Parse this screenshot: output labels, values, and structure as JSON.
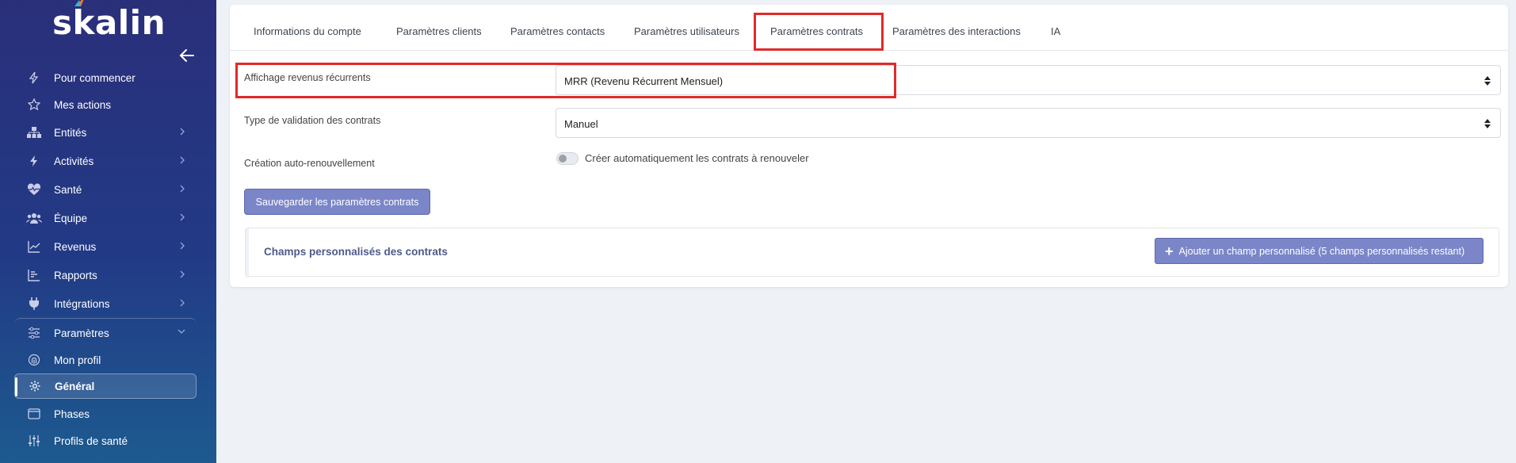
{
  "sidebar": {
    "logo": "skalin",
    "items": [
      {
        "name": "pour-commencer",
        "label": "Pour commencer",
        "icon": "bolt-icon"
      },
      {
        "name": "mes-actions",
        "label": "Mes actions",
        "icon": "star-icon"
      },
      {
        "name": "entites",
        "label": "Entités",
        "icon": "org-chart-icon"
      },
      {
        "name": "activites",
        "label": "Activités",
        "icon": "bolt-filled-icon"
      },
      {
        "name": "sante",
        "label": "Santé",
        "icon": "heart-pulse-icon"
      },
      {
        "name": "equipe",
        "label": "Équipe",
        "icon": "users-icon"
      },
      {
        "name": "revenus",
        "label": "Revenus",
        "icon": "line-chart-icon"
      },
      {
        "name": "rapports",
        "label": "Rapports",
        "icon": "bar-chart-icon"
      },
      {
        "name": "integrations",
        "label": "Intégrations",
        "icon": "plug-icon"
      }
    ],
    "settings": {
      "label": "Paramètres",
      "sub": [
        {
          "name": "mon-profil",
          "label": "Mon profil",
          "icon": "fingerprint-icon"
        },
        {
          "name": "general",
          "label": "Général",
          "icon": "gear-icon",
          "active": true
        },
        {
          "name": "phases",
          "label": "Phases",
          "icon": "window-icon"
        },
        {
          "name": "profils-sante",
          "label": "Profils de santé",
          "icon": "sliders-icon"
        }
      ]
    }
  },
  "tabs": [
    {
      "label": "Informations du compte"
    },
    {
      "label": "Paramètres clients"
    },
    {
      "label": "Paramètres contacts"
    },
    {
      "label": "Paramètres utilisateurs"
    },
    {
      "label": "Paramètres contrats",
      "active": true
    },
    {
      "label": "Paramètres des interactions"
    },
    {
      "label": "IA"
    }
  ],
  "form": {
    "revenue_label": "Affichage revenus récurrents",
    "revenue_value": "MRR (Revenu Récurrent Mensuel)",
    "validation_label": "Type de validation des contrats",
    "validation_value": "Manuel",
    "renewal_label": "Création auto-renouvellement",
    "renewal_toggle_label": "Créer automatiquement les contrats à renouveler",
    "renewal_enabled": false,
    "save_label": "Sauvegarder les paramètres contrats"
  },
  "custom_fields": {
    "title": "Champs personnalisés des contrats",
    "add_label": "Ajouter un champ personnalisé (5 champs personnalisés restant)"
  },
  "colors": {
    "sidebar": "#2a2f7a",
    "primary_button": "#7b86c9",
    "highlight": "#e02a2a"
  }
}
